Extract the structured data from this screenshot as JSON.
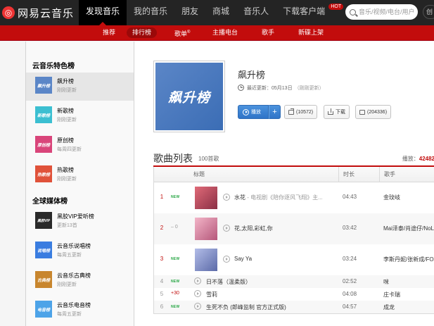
{
  "app": {
    "logo_letter": "◎",
    "logo_text": "网易云音乐"
  },
  "topnav": {
    "items": [
      "发现音乐",
      "我的音乐",
      "朋友",
      "商城",
      "音乐人",
      "下载客户端"
    ],
    "hot_badge": "HOT",
    "search_placeholder": "音乐/视频/电台/用户",
    "creator_label": "创"
  },
  "subnav": {
    "items": [
      "推荐",
      "排行榜",
      "歌单",
      "主播电台",
      "歌手",
      "新碟上架"
    ],
    "playlist_sup": "®"
  },
  "sidebar": {
    "section1_title": "云音乐特色榜",
    "section2_title": "全球媒体榜",
    "items": [
      {
        "name": "飙升榜",
        "sub": "刚刚更新",
        "cover_text": "飙升榜",
        "color": "#5b86c7"
      },
      {
        "name": "新歌榜",
        "sub": "刚刚更新",
        "cover_text": "新歌榜",
        "color": "#3cbfd1"
      },
      {
        "name": "原创榜",
        "sub": "每周四更新",
        "cover_text": "原创榜",
        "color": "#d9457a"
      },
      {
        "name": "热歌榜",
        "sub": "刚刚更新",
        "cover_text": "热歌榜",
        "color": "#e0523a"
      },
      {
        "name": "黑胶VIP爱听榜",
        "sub": "更新13首",
        "cover_text": "黑胶VIP",
        "color": "#2a2a2a"
      },
      {
        "name": "云音乐说唱榜",
        "sub": "每周五更新",
        "cover_text": "说唱榜",
        "color": "#3a7de0"
      },
      {
        "name": "云音乐古典榜",
        "sub": "刚刚更新",
        "cover_text": "古典榜",
        "color": "#c8862e"
      },
      {
        "name": "云音乐电音榜",
        "sub": "每周五更新",
        "cover_text": "电音榜",
        "color": "#4da3e8"
      }
    ]
  },
  "header": {
    "cover_text": "飙升榜",
    "title": "飙升榜",
    "update_label": "最近更新：05月13日",
    "update_freq": "（刚刚更新）",
    "play_label": "播放",
    "add_label": "+",
    "share_label": "(10572)",
    "download_label": "下载",
    "comment_label": "(204336)"
  },
  "songlist": {
    "title": "歌曲列表",
    "count": "100首歌",
    "play_count_label": "播放：",
    "play_count_value": "42482",
    "columns": [
      "标题",
      "时长",
      "歌手"
    ],
    "rows": [
      {
        "rank": "1",
        "trend": "NEW",
        "title": "水花",
        "alias": " - 电视剧《陪你逐风飞翔》主...",
        "duration": "04:43",
        "artist": "金玟岐",
        "thumb_color": "#c0455a"
      },
      {
        "rank": "2",
        "trend": "– 0",
        "title": "花,太阳,彩虹,你",
        "alias": "",
        "duration": "03:42",
        "artist": "Mai泽泰/肖途仔/NoLo",
        "thumb_color": "#e07fa0"
      },
      {
        "rank": "3",
        "trend": "NEW",
        "title": "Say Ya",
        "alias": "",
        "duration": "03:24",
        "artist": "李斯丹妮/张新成/FOX",
        "thumb_color": "#7a8ad0"
      },
      {
        "rank": "4",
        "trend": "NEW",
        "title": "日不落（温柔版）",
        "alias": "",
        "duration": "02:52",
        "artist": "咪",
        "thumb_color": ""
      },
      {
        "rank": "5",
        "trend": "+30",
        "title": "雪莉",
        "alias": "",
        "duration": "04:08",
        "artist": "庄卡瑞",
        "thumb_color": ""
      },
      {
        "rank": "6",
        "trend": "NEW",
        "title": "生死不负 (郎峰监制 官方正式版)",
        "alias": "",
        "duration": "04:57",
        "artist": "成龙",
        "thumb_color": ""
      }
    ]
  }
}
